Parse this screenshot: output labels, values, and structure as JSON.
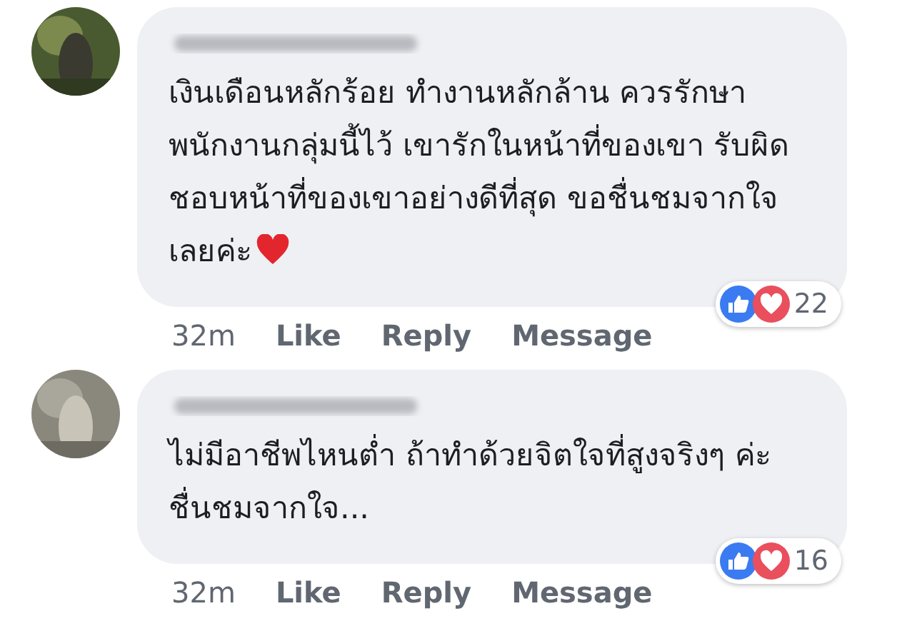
{
  "comments": [
    {
      "text": "เงินเดือนหลักร้อย ทำงานหลักล้าน ควรรักษาพนักงานกลุ่มนี้ไว้ เขารักในหน้าที่ของเขา รับผิดชอบหน้าที่ของเขาอย่างดีที่สุด ขอชื่นชมจากใจเลยค่ะ",
      "heart": true,
      "time": "32m",
      "actions": [
        "Like",
        "Reply",
        "Message"
      ],
      "reaction_count": "22"
    },
    {
      "text": "ไม่มีอาชีพไหนต่ำ ถ้าทำด้วยจิตใจที่สูงจริงๆ ค่ะ ชื่นชมจากใจ...",
      "heart": false,
      "time": "32m",
      "actions": [
        "Like",
        "Reply",
        "Message"
      ],
      "reaction_count": "16"
    }
  ]
}
